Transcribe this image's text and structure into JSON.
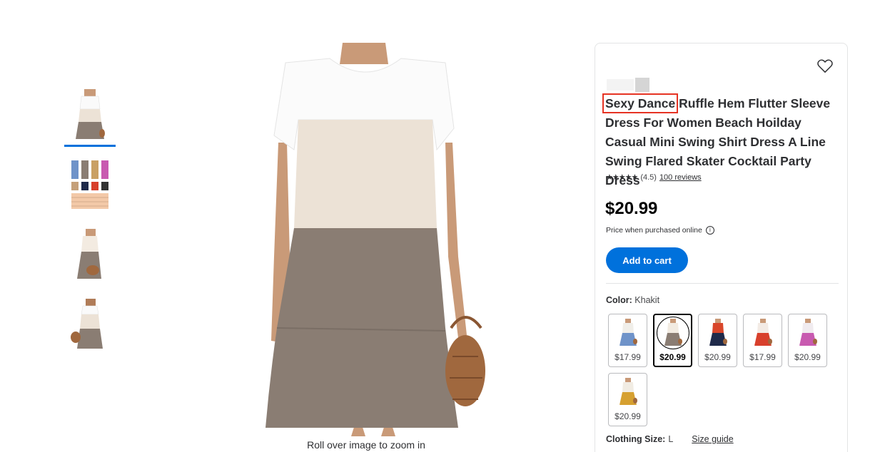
{
  "thumbnails": [
    {
      "icon": "dress-front-thumbnail",
      "active": true
    },
    {
      "icon": "color-chart-thumbnail",
      "active": false
    },
    {
      "icon": "dress-side-thumbnail",
      "active": false
    },
    {
      "icon": "dress-back-thumbnail",
      "active": false
    }
  ],
  "main_image": {
    "icon": "dress-main-photo",
    "zoom_hint": "Roll over image to zoom in"
  },
  "product": {
    "title_highlight": "Sexy Dance",
    "title_rest": " Ruffle Hem Flutter Sleeve Dress For Women Beach Hoilday Casual Mini Swing Shirt Dress A Line Swing Flared Skater Cocktail Party Dress",
    "stars": "★★★★★",
    "rating_value": 4.5,
    "rating_text": "(4.5)",
    "reviews": "100 reviews",
    "price": "$20.99",
    "price_note": "Price when purchased online",
    "info_icon": "i",
    "add_to_cart": "Add to cart",
    "color_label": "Color:",
    "color_value": "Khakit",
    "size_label": "Clothing Size:",
    "size_value": "L",
    "size_guide": "Size guide"
  },
  "swatches": [
    {
      "price": "$17.99",
      "top": "#f0eee9",
      "bottom": "#6f93c9",
      "selected": false
    },
    {
      "price": "$20.99",
      "top": "#f2ebe1",
      "bottom": "#8a7d73",
      "selected": true
    },
    {
      "price": "$20.99",
      "top": "#d9462a",
      "bottom": "#1f2a4a",
      "selected": false
    },
    {
      "price": "$17.99",
      "top": "#f3ebe5",
      "bottom": "#d8402c",
      "selected": false
    },
    {
      "price": "$20.99",
      "top": "#f0ebef",
      "bottom": "#c85ab0",
      "selected": false
    },
    {
      "price": "$20.99",
      "top": "#f1ece3",
      "bottom": "#d6a030",
      "selected": false
    }
  ],
  "colors": {
    "accent": "#0071dc",
    "highlight_box": "#e63323"
  }
}
